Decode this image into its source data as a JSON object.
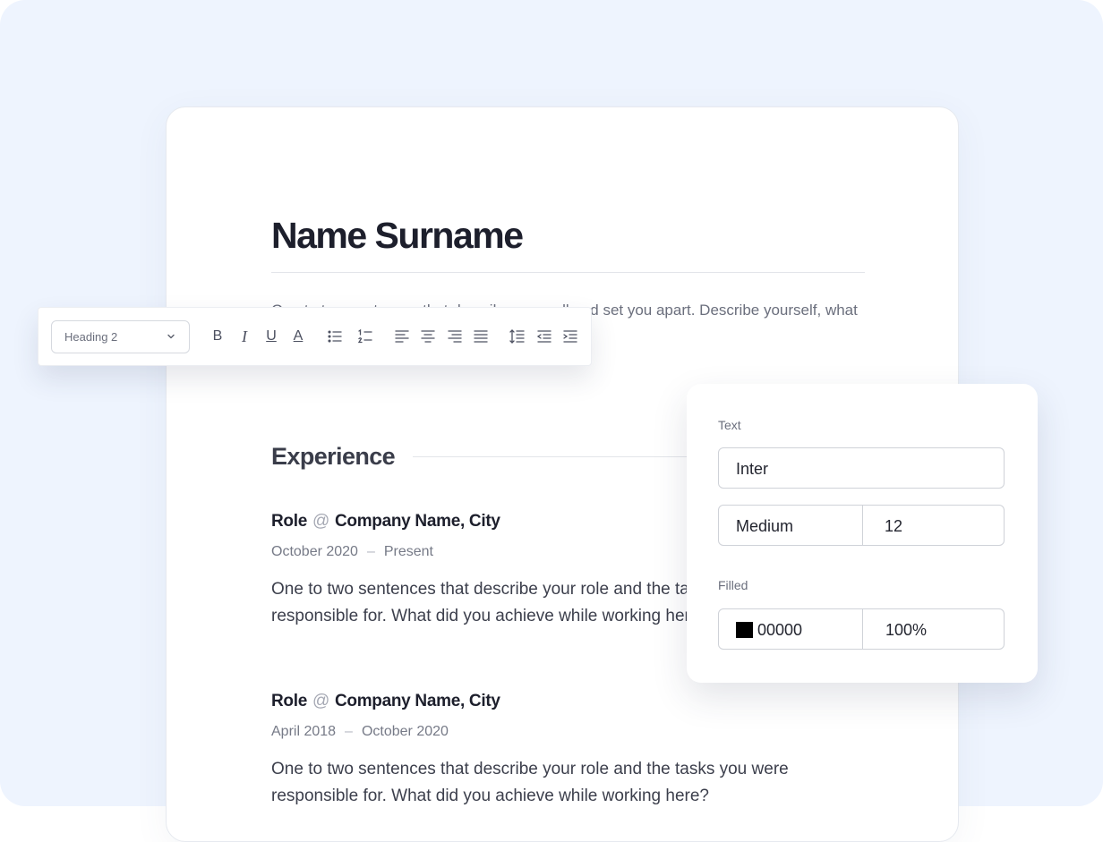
{
  "resume": {
    "name": "Name Surname",
    "summary": "One to two sentences that describe you well and set you apart. Describe yourself, what makes you a great candidate.",
    "section_title": "Experience",
    "jobs": [
      {
        "role": "Role",
        "at": "@",
        "company": "Company Name, City",
        "start": "October 2020",
        "dash": "–",
        "end": "Present",
        "description": "One to two sentences that describe your role and the tasks you were responsible for. What did you achieve while working here?"
      },
      {
        "role": "Role",
        "at": "@",
        "company": "Company Name, City",
        "start": "April 2018",
        "dash": "–",
        "end": "October 2020",
        "description": "One to two sentences that describe your role and the tasks you were responsible for. What did you achieve while working here?"
      }
    ]
  },
  "toolbar": {
    "style_select": "Heading 2",
    "bold": "B",
    "italic": "I",
    "underline": "U",
    "text_color": "A",
    "icons": [
      "chevron-down-icon",
      "bulleted-list-icon",
      "numbered-list-icon",
      "align-left-icon",
      "align-center-icon",
      "align-right-icon",
      "align-justify-icon",
      "line-height-icon",
      "outdent-icon",
      "indent-icon"
    ]
  },
  "text_panel": {
    "text_label": "Text",
    "font_family": "Inter",
    "font_weight": "Medium",
    "font_size": "12",
    "fill_label": "Filled",
    "fill_hex": "00000",
    "fill_opacity": "100%",
    "fill_color": "#000000"
  },
  "colors": {
    "background": "#eef4fe",
    "heading": "#1d1f2c",
    "muted": "#6b6f7d"
  }
}
